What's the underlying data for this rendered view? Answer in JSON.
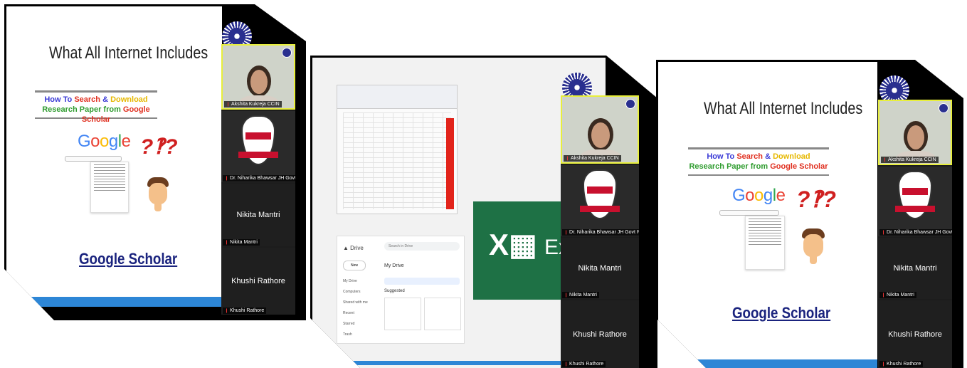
{
  "slides": [
    {
      "title": "What All Internet Includes",
      "banner_line1a": "How To ",
      "banner_line1b": "Search",
      "banner_line1c": " & ",
      "banner_line1d": "Download",
      "banner_line2a": "Research Paper from ",
      "banner_line2b": "Google Scholar",
      "google_logo": "Google",
      "question_marks": "?‽?",
      "footer_link": "Google Scholar"
    },
    {
      "excel_text": "Exc"
    },
    {
      "title": "What All Internet Includes",
      "banner_line1a": "How To ",
      "banner_line1b": "Search",
      "banner_line1c": " & ",
      "banner_line1d": "Download",
      "banner_line2a": "Research Paper from ",
      "banner_line2b": "Google Scholar",
      "google_logo": "Google",
      "question_marks": "?‽?",
      "footer_link": "Google Scholar"
    }
  ],
  "participants": {
    "akshita": "Akshita Kukreja CCIN",
    "niharika": "Dr. Niharika Bhawsar JH Govt PG Co...",
    "nikita": "Nikita Mantri",
    "khushi": "Khushi Rathore"
  },
  "drive": {
    "app_name": "Drive",
    "search_placeholder": "Search in Drive",
    "new_button": "New",
    "my_drive": "My Drive",
    "suggested": "Suggested",
    "side_items": [
      "My Drive",
      "Computers",
      "Shared with me",
      "Recent",
      "Starred",
      "Trash"
    ]
  },
  "colors": {
    "accent_blue": "#2d86d6",
    "excel_green": "#1e7145",
    "camera_border": "#e8ef3c"
  }
}
